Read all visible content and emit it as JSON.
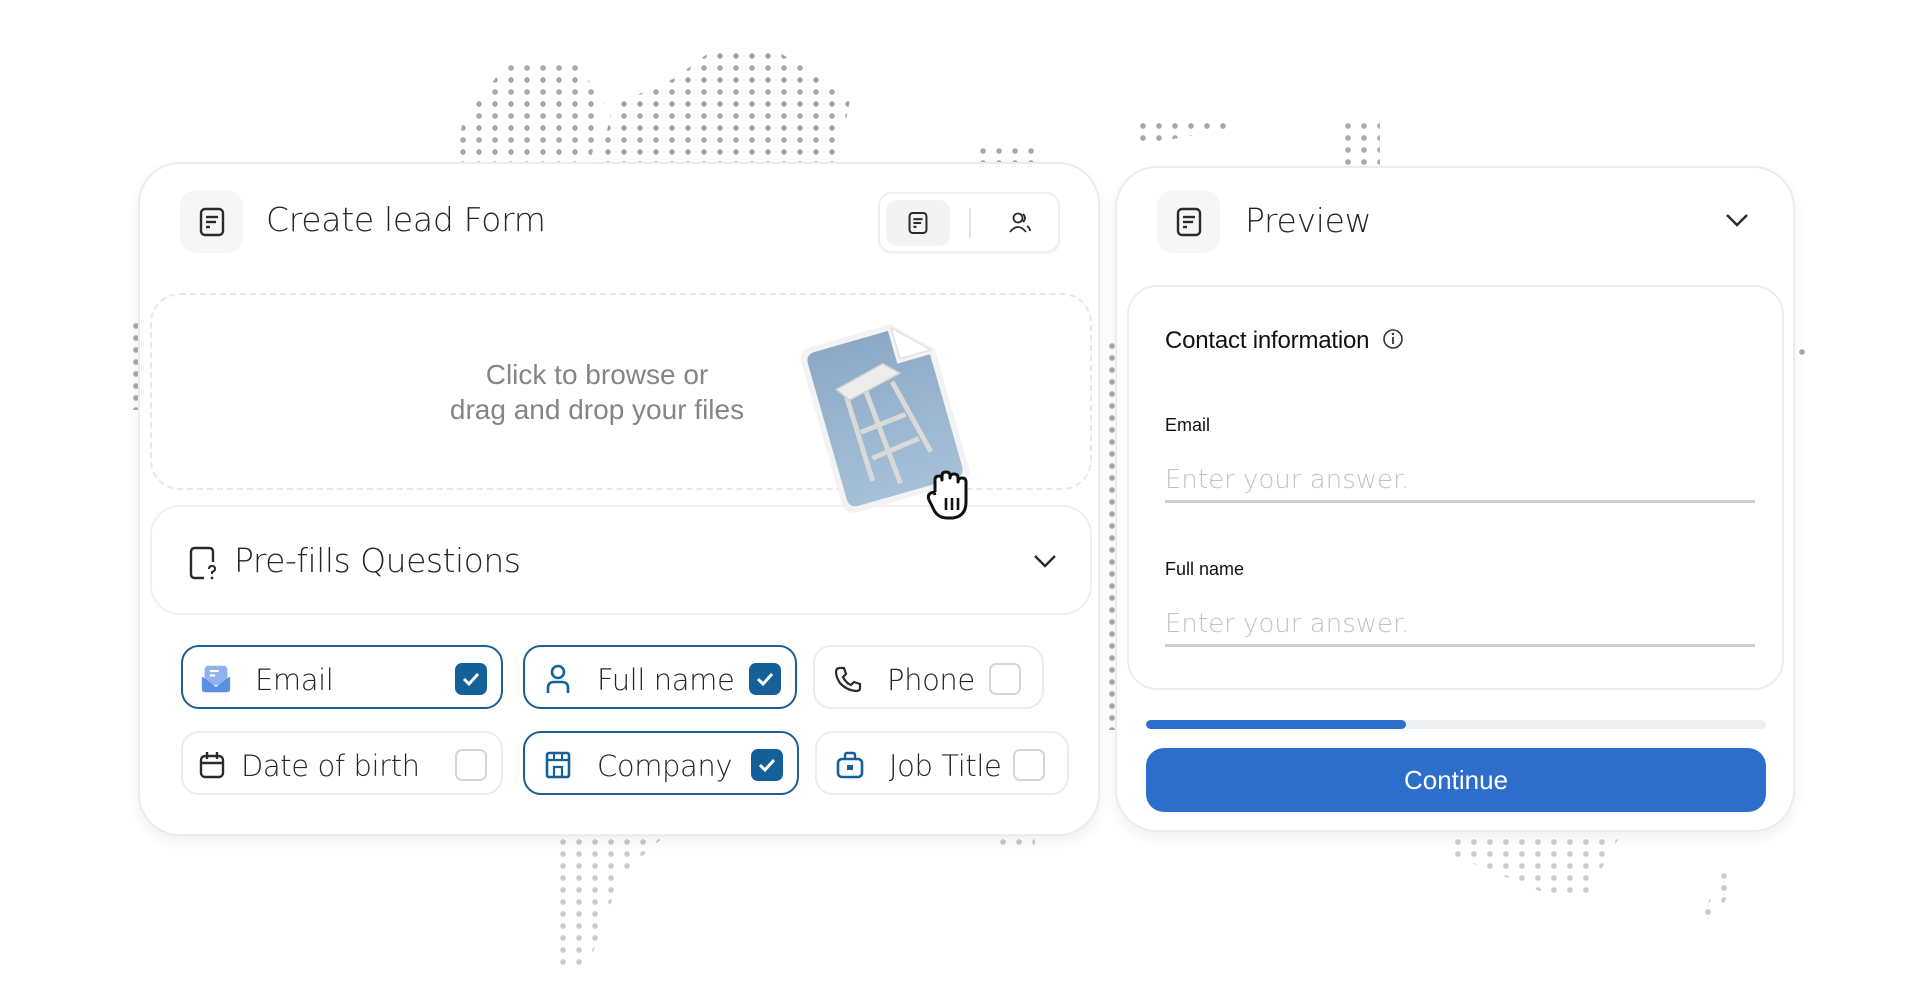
{
  "left_panel": {
    "title": "Create lead Form",
    "header_icon": "form-document-icon",
    "toggle": [
      {
        "icon": "form-document-icon",
        "active": true
      },
      {
        "icon": "users-icon",
        "active": false
      }
    ],
    "dropzone": {
      "line1": "Click to browse or",
      "line2": "drag and drop your files",
      "dragged_file": "stool-photo"
    },
    "prefill": {
      "title": "Pre-fills Questions",
      "icon": "question-square-icon",
      "expand_icon": "chevron-down-icon",
      "chips": [
        {
          "label": "Email",
          "icon": "envelope-icon",
          "checked": true
        },
        {
          "label": "Full name",
          "icon": "user-icon",
          "checked": true
        },
        {
          "label": "Phone",
          "icon": "phone-icon",
          "checked": false
        },
        {
          "label": "Date of birth",
          "icon": "calendar-icon",
          "checked": false
        },
        {
          "label": "Company",
          "icon": "building-icon",
          "checked": true
        },
        {
          "label": "Job Title",
          "icon": "briefcase-icon",
          "checked": false
        }
      ]
    }
  },
  "right_panel": {
    "title": "Preview",
    "header_icon": "form-document-icon",
    "collapse_icon": "chevron-down-icon",
    "section_title": "Contact information",
    "section_info_icon": "info-icon",
    "fields": [
      {
        "label": "Email",
        "value": "",
        "placeholder": "Enter your answer."
      },
      {
        "label": "Full name",
        "value": "",
        "placeholder": "Enter your answer."
      }
    ],
    "progress_percent": 42,
    "continue_label": "Continue"
  },
  "colors": {
    "accent_blue": "#2d6dcc",
    "checkbox_blue": "#14619a",
    "chip_selected_border": "#1c5f95",
    "dot_gray": "#a9a9a9"
  }
}
